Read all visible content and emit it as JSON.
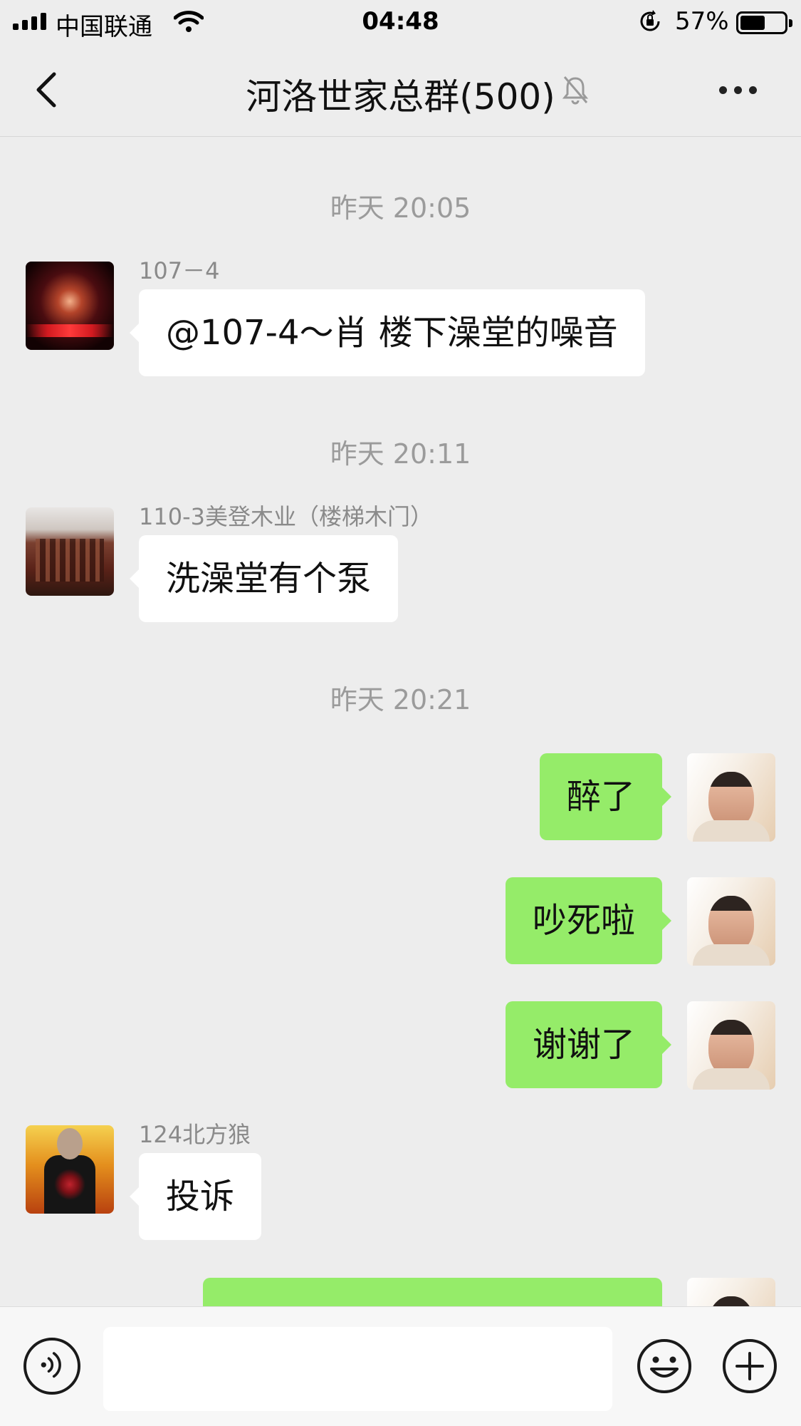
{
  "status_bar": {
    "carrier": "中国联通",
    "time": "04:48",
    "battery_percent": "57%",
    "battery_level": 0.57
  },
  "header": {
    "title": "河洛世家总群(500)",
    "muted": true
  },
  "messages": [
    {
      "type": "time",
      "text": "昨天 20:05"
    },
    {
      "type": "incoming",
      "sender": "107－4",
      "text": "@107-4～肖 楼下澡堂的噪音"
    },
    {
      "type": "time",
      "text": "昨天 20:11"
    },
    {
      "type": "incoming",
      "sender": "110-3美登木业（楼梯木门）",
      "text": "洗澡堂有个泵"
    },
    {
      "type": "time",
      "text": "昨天 20:21"
    },
    {
      "type": "outgoing",
      "text": "醉了"
    },
    {
      "type": "outgoing",
      "text": "吵死啦"
    },
    {
      "type": "outgoing",
      "text": "谢谢了"
    },
    {
      "type": "incoming",
      "sender": "124北方狼",
      "text": "投诉"
    }
  ],
  "input": {
    "value": "",
    "placeholder": ""
  },
  "colors": {
    "background": "#ededed",
    "outgoing_bubble": "#95ec69",
    "incoming_bubble": "#ffffff",
    "timestamp_text": "#9b9b9b"
  },
  "icons": [
    "signal-icon",
    "wifi-icon",
    "rotation-lock-icon",
    "battery-icon",
    "back-icon",
    "mute-bell-icon",
    "more-icon",
    "voice-icon",
    "emoji-icon",
    "plus-icon"
  ]
}
